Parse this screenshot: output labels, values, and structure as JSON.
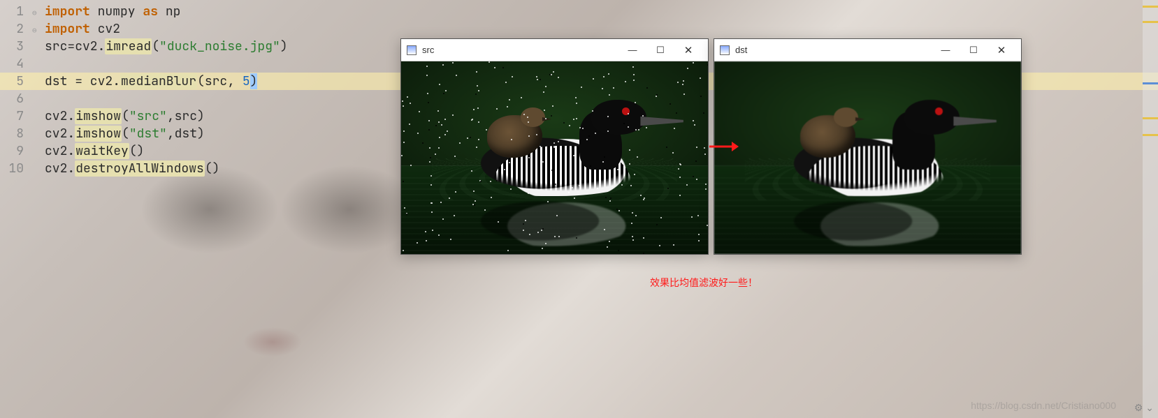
{
  "code": {
    "lines": [
      {
        "n": "1",
        "fold": "⊖",
        "tokens": [
          {
            "t": "import ",
            "c": "kw"
          },
          {
            "t": "numpy ",
            "c": ""
          },
          {
            "t": "as ",
            "c": "kw"
          },
          {
            "t": "np",
            "c": ""
          }
        ]
      },
      {
        "n": "2",
        "fold": "⊖",
        "tokens": [
          {
            "t": "import ",
            "c": "kw"
          },
          {
            "t": "cv2",
            "c": ""
          }
        ]
      },
      {
        "n": "3",
        "fold": "",
        "tokens": [
          {
            "t": "src=cv2.",
            "c": ""
          },
          {
            "t": "imread",
            "c": "hl-yel"
          },
          {
            "t": "(",
            "c": ""
          },
          {
            "t": "\"duck_noise.jpg\"",
            "c": "str"
          },
          {
            "t": ")",
            "c": ""
          }
        ]
      },
      {
        "n": "4",
        "fold": "",
        "tokens": []
      },
      {
        "n": "5",
        "fold": "",
        "hl": true,
        "tokens": [
          {
            "t": "dst = cv2.",
            "c": ""
          },
          {
            "t": "medianBlur",
            "c": "hl-yel"
          },
          {
            "t": "(",
            "c": ""
          },
          {
            "t": "src, ",
            "c": ""
          },
          {
            "t": "5",
            "c": "num"
          },
          {
            "t": ")",
            "c": "sel"
          }
        ]
      },
      {
        "n": "6",
        "fold": "",
        "tokens": []
      },
      {
        "n": "7",
        "fold": "",
        "tokens": [
          {
            "t": "cv2.",
            "c": ""
          },
          {
            "t": "imshow",
            "c": "hl-yel"
          },
          {
            "t": "(",
            "c": ""
          },
          {
            "t": "\"src\"",
            "c": "str"
          },
          {
            "t": ",src)",
            "c": ""
          }
        ]
      },
      {
        "n": "8",
        "fold": "",
        "tokens": [
          {
            "t": "cv2.",
            "c": ""
          },
          {
            "t": "imshow",
            "c": "hl-yel"
          },
          {
            "t": "(",
            "c": ""
          },
          {
            "t": "\"dst\"",
            "c": "str"
          },
          {
            "t": ",dst)",
            "c": ""
          }
        ]
      },
      {
        "n": "9",
        "fold": "",
        "tokens": [
          {
            "t": "cv2.",
            "c": ""
          },
          {
            "t": "waitKey",
            "c": "hl-yel"
          },
          {
            "t": "()",
            "c": ""
          }
        ]
      },
      {
        "n": "10",
        "fold": "",
        "tokens": [
          {
            "t": "cv2.",
            "c": ""
          },
          {
            "t": "destroyAllWindows",
            "c": "hl-yel"
          },
          {
            "t": "()",
            "c": ""
          }
        ]
      }
    ]
  },
  "windows": {
    "src": {
      "title": "src",
      "min": "—",
      "max": "☐",
      "close": "✕"
    },
    "dst": {
      "title": "dst",
      "min": "—",
      "max": "☐",
      "close": "✕"
    }
  },
  "arrow_color": "#ff1a1a",
  "caption": "效果比均值滤波好一些！",
  "watermark": "https://blog.csdn.net/Cristiano000"
}
